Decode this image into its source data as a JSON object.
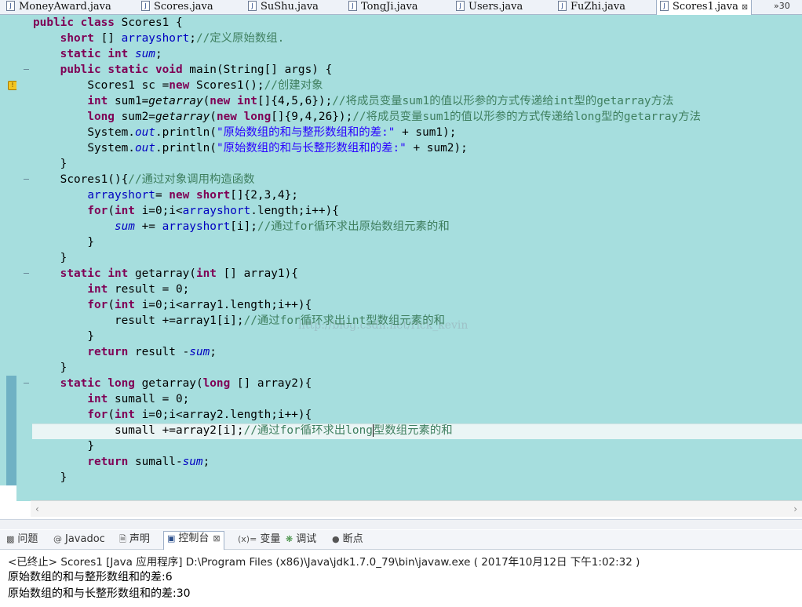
{
  "tabs": [
    {
      "label": "MoneyAward.java",
      "active": false
    },
    {
      "label": "Scores.java",
      "active": false
    },
    {
      "label": "SuShu.java",
      "active": false
    },
    {
      "label": "TongJi.java",
      "active": false
    },
    {
      "label": "Users.java",
      "active": false
    },
    {
      "label": "FuZhi.java",
      "active": false
    },
    {
      "label": "Scores1.java",
      "active": true
    }
  ],
  "tab_close_glyph": "⊠",
  "tab_overflow": "»30",
  "editor": {
    "line1": [
      "public",
      "class",
      "Scores1 {"
    ],
    "line2": [
      "short",
      " [] ",
      "arrayshort",
      ";",
      "//定义原始数组."
    ],
    "line3": [
      "static",
      "int",
      "sum",
      ";"
    ],
    "line4": [
      "public",
      "static",
      "void",
      " main(String[] args) {"
    ],
    "line5": [
      "Scores1 sc =",
      "new",
      " Scores1();",
      "//创建对象"
    ],
    "line6": [
      "int",
      " sum1=",
      "getarray",
      "(",
      "new",
      "int",
      "[]{4,5,6});",
      "//将成员变量sum1的值以形参的方式传递给int型的getarray方法"
    ],
    "line7": [
      "long",
      " sum2=",
      "getarray",
      "(",
      "new",
      "long",
      "[]{9,4,26});",
      "//将成员变量sum1的值以形参的方式传递给long型的getarray方法"
    ],
    "line8": [
      "System.",
      "out",
      ".println(",
      "\"原始数组的和与整形数组和的差:\"",
      " + sum1);"
    ],
    "line9": [
      "System.",
      "out",
      ".println(",
      "\"原始数组的和与长整形数组和的差:\"",
      " + sum2);"
    ],
    "line10": [
      "}"
    ],
    "line11": [
      "Scores1(){",
      "//通过对象调用构造函数"
    ],
    "line12": [
      "arrayshort",
      "= ",
      "new",
      "short",
      "[]{2,3,4};"
    ],
    "line13": [
      "for",
      "(",
      "int",
      " i=0;i<",
      "arrayshort",
      ".length;i++){"
    ],
    "line14": [
      "sum",
      " += ",
      "arrayshort",
      "[i];",
      "//通过for循环求出原始数组元素的和"
    ],
    "line15": [
      "}"
    ],
    "line16": [
      "}"
    ],
    "line17": [
      "static",
      "int",
      " getarray(",
      "int",
      " [] array1){"
    ],
    "line18": [
      "int",
      " result = 0;"
    ],
    "line19": [
      "for",
      "(",
      "int",
      " i=0;i<array1.length;i++){"
    ],
    "line20": [
      "result +=array1[i];",
      "//通过for循环求出int型数组元素的和"
    ],
    "line21": [
      "}"
    ],
    "line22": [
      "return",
      " result -",
      "sum",
      ";"
    ],
    "line23": [
      "}"
    ],
    "line24": [
      "static",
      "long",
      " getarray(",
      "long",
      " [] array2){"
    ],
    "line25": [
      "int",
      " sumall = 0;"
    ],
    "line26": [
      "for",
      "(",
      "int",
      " i=0;i<array2.length;i++){"
    ],
    "line27": [
      "sumall +=array2[i];",
      "//通过for循环求出long",
      "型数组元素的和"
    ],
    "line28": [
      "}"
    ],
    "line29": [
      "return",
      " sumall-",
      "sum",
      ";"
    ],
    "line30": [
      "}"
    ],
    "watermark": "http://blog.csdn.net/rick_kevin"
  },
  "panel": {
    "tabs": [
      {
        "label": "问题",
        "icon": "problems-icon"
      },
      {
        "label": "Javadoc",
        "icon": "javadoc-icon"
      },
      {
        "label": "声明",
        "icon": "declaration-icon"
      },
      {
        "label": "控制台",
        "icon": "console-icon",
        "active": true
      },
      {
        "label": "变量",
        "icon": "variables-icon"
      },
      {
        "label": "调试",
        "icon": "debug-icon"
      },
      {
        "label": "断点",
        "icon": "breakpoints-icon"
      }
    ],
    "console_close_glyph": "⊠"
  },
  "console": {
    "header": "<已终止> Scores1 [Java 应用程序] D:\\Program Files (x86)\\Java\\jdk1.7.0_79\\bin\\javaw.exe ( 2017年10月12日 下午1:02:32 )",
    "line1": "原始数组的和与整形数组和的差:6",
    "line2": "原始数组的和与长整形数组和的差:30"
  },
  "colors": {
    "editor_bg": "#a6dede",
    "keyword": "#7f0055",
    "comment": "#3f7f5f",
    "string": "#2a00ff",
    "field": "#0000c0"
  }
}
